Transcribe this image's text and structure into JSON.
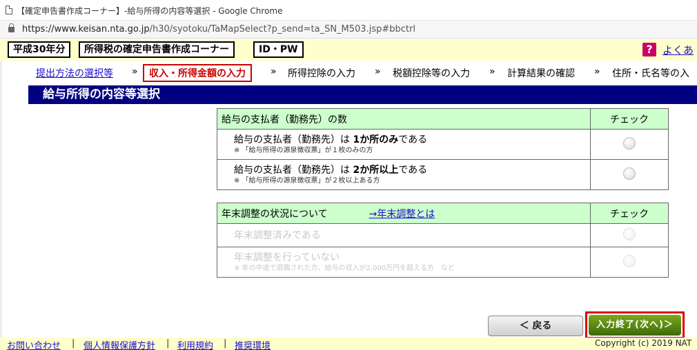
{
  "browser": {
    "title": "【確定申告書作成コーナー】-給与所得の内容等選択 - Google Chrome",
    "url_host": "https://www.keisan.nta.go.jp",
    "url_path": "/h30/syotoku/TaMapSelect?p_send=ta_SN_M503.jsp#bbctrl"
  },
  "header": {
    "year_label": "平成30年分",
    "corner_label": "所得税の確定申告書作成コーナー",
    "id_label": "ID・PW",
    "help_icon": "?",
    "help_link": "よくあ"
  },
  "steps": [
    {
      "label": "提出方法の選択等"
    },
    {
      "label": "収入・所得金額の入力"
    },
    {
      "label": "所得控除の入力"
    },
    {
      "label": "税額控除等の入力"
    },
    {
      "label": "計算結果の確認"
    },
    {
      "label": "住所・氏名等の入"
    }
  ],
  "step_separator": "»",
  "page_title": "給与所得の内容等選択",
  "table1": {
    "header": "給与の支払者（勤務先）の数",
    "check_header": "チェック",
    "options": [
      {
        "pre": "給与の支払者（勤務先）は ",
        "bold": "1か所のみ",
        "post": "である",
        "note": "※ 「給与所得の源泉徴収票」が１枚のみの方"
      },
      {
        "pre": "給与の支払者（勤務先）は ",
        "bold": "2か所以上",
        "post": "である",
        "note": "※ 「給与所得の源泉徴収票」が２枚以上ある方"
      }
    ]
  },
  "table2": {
    "header": "年末調整の状況について",
    "header_link": "→年末調整とは",
    "check_header": "チェック",
    "options": [
      {
        "label": "年末調整済みである",
        "note": ""
      },
      {
        "label": "年末調整を行っていない",
        "note": "※ 年の中途で退職された方、給与の収入が2,000万円を超える方　など"
      }
    ]
  },
  "buttons": {
    "back": "＜ 戻る",
    "next": "入力終了(次へ)＞"
  },
  "footer": {
    "links": [
      "お問い合わせ",
      "個人情報保護方針",
      "利用規約",
      "推奨環境"
    ],
    "separator": "|",
    "copyright": "Copyright (c) 2019 NAT"
  }
}
